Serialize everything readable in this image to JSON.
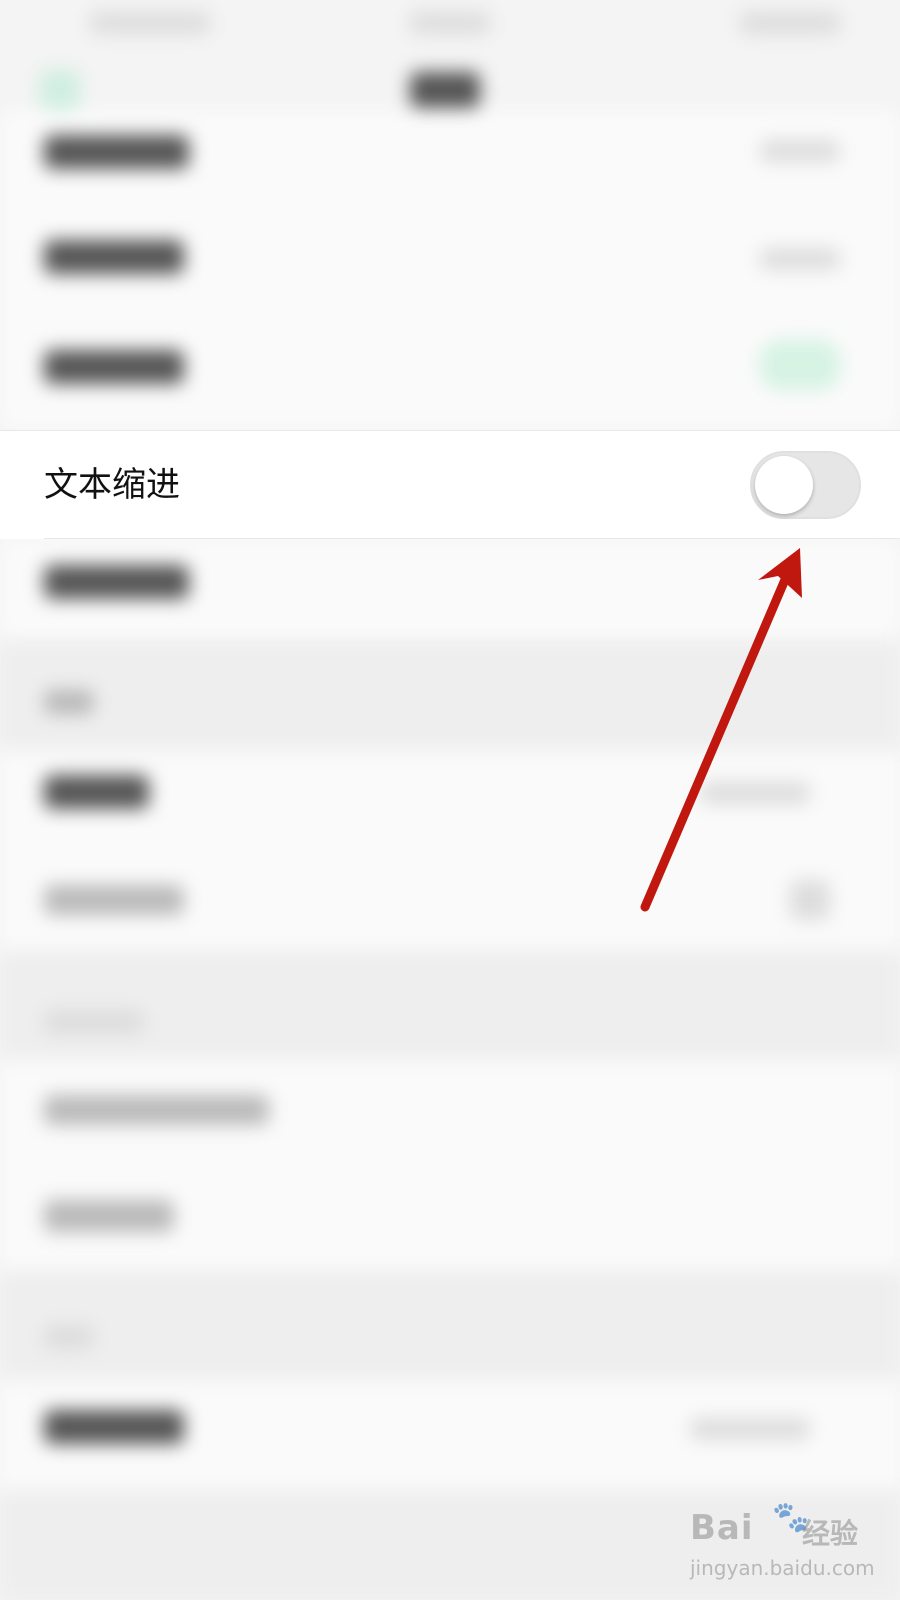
{
  "settings_row": {
    "label": "文本缩进",
    "toggle_on": false
  },
  "watermark": {
    "brand": "Bai",
    "paw": "🐾",
    "cn": "经验",
    "url": "jingyan.baidu.com"
  },
  "colors": {
    "annotation_arrow": "#c0180f",
    "toggle_off_track": "#e6e6e6",
    "row_background": "#ffffff",
    "page_background": "#f4f4f4"
  },
  "icons": [
    "toggle-switch",
    "annotation-arrow",
    "baidu-paw-logo"
  ]
}
